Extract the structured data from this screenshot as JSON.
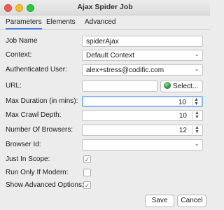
{
  "window": {
    "title": "Ajax Spider Job"
  },
  "tabs": [
    {
      "label": "Parameters",
      "active": true
    },
    {
      "label": "Elements",
      "active": false
    },
    {
      "label": "Advanced",
      "active": false
    }
  ],
  "form": {
    "job_name": {
      "label": "Job Name",
      "value": "spiderAjax"
    },
    "context": {
      "label": "Context:",
      "value": "Default Context"
    },
    "auth_user": {
      "label": "Authenticated User:",
      "value": "alex+stress@codific.com"
    },
    "url": {
      "label": "URL:",
      "value": "",
      "button": "Select..."
    },
    "max_duration": {
      "label": "Max Duration (in mins):",
      "value": "10"
    },
    "max_crawl_depth": {
      "label": "Max Crawl Depth:",
      "value": "10"
    },
    "num_browsers": {
      "label": "Number Of Browsers:",
      "value": "12"
    },
    "browser_id": {
      "label": "Browser Id:",
      "value": ""
    },
    "just_in_scope": {
      "label": "Just In Scope:",
      "checked": true
    },
    "run_if_modern": {
      "label": "Run Only If Modern:",
      "checked": false
    },
    "show_advanced": {
      "label": "Show Advanced Options:",
      "checked": true
    }
  },
  "buttons": {
    "save": "Save",
    "cancel": "Cancel"
  },
  "icons": {
    "checkmark": "✓",
    "chevron": "⌄",
    "stepper_up": "▲",
    "stepper_down": "▼"
  },
  "colors": {
    "accent": "#3b7de8"
  }
}
